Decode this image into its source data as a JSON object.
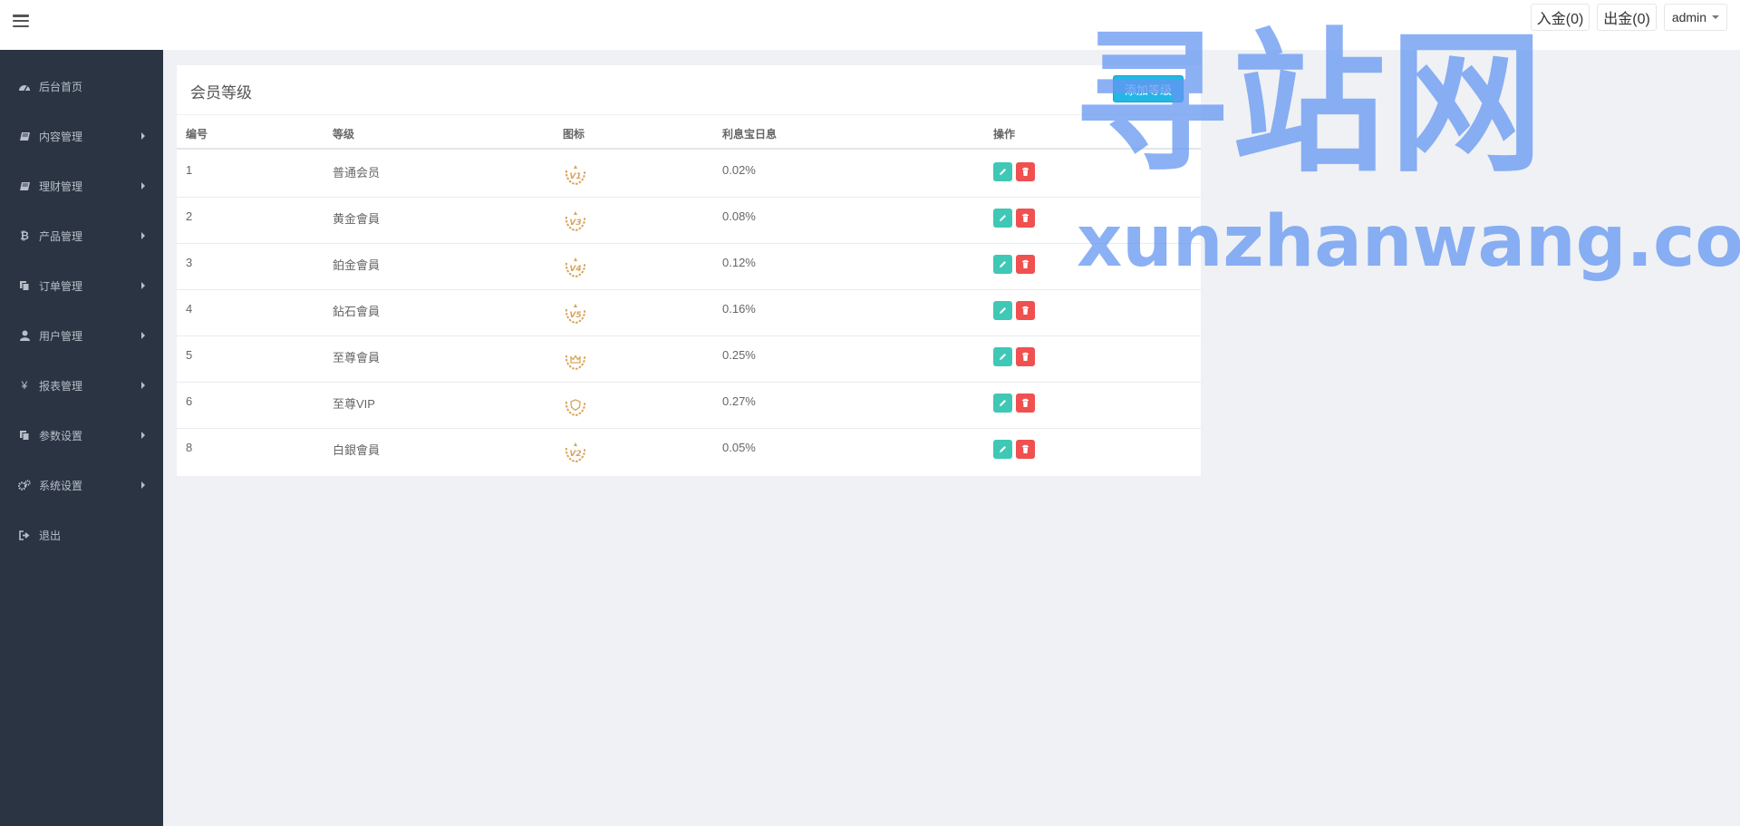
{
  "topbar": {
    "deposit_label": "入金(0)",
    "withdraw_label": "出金(0)",
    "user_label": "admin"
  },
  "sidebar": {
    "items": [
      {
        "label": "后台首页",
        "icon": "dashboard-icon",
        "has_arrow": false
      },
      {
        "label": "内容管理",
        "icon": "book-icon",
        "has_arrow": true
      },
      {
        "label": "理财管理",
        "icon": "book-icon",
        "has_arrow": true
      },
      {
        "label": "产品管理",
        "icon": "bitcoin-icon",
        "has_arrow": true
      },
      {
        "label": "订单管理",
        "icon": "copy-icon",
        "has_arrow": true
      },
      {
        "label": "用户管理",
        "icon": "user-icon",
        "has_arrow": true
      },
      {
        "label": "报表管理",
        "icon": "yen-icon",
        "has_arrow": true
      },
      {
        "label": "参数设置",
        "icon": "copy-icon",
        "has_arrow": true
      },
      {
        "label": "系统设置",
        "icon": "gears-icon",
        "has_arrow": true
      },
      {
        "label": "退出",
        "icon": "sign-out-icon",
        "has_arrow": false
      }
    ]
  },
  "panel": {
    "title": "会员等级",
    "add_button": "添加等级",
    "columns": [
      "编号",
      "等级",
      "图标",
      "利息宝日息",
      "操作"
    ],
    "rows": [
      {
        "id": "1",
        "level": "普通会员",
        "badge": "V1",
        "rate": "0.02%"
      },
      {
        "id": "2",
        "level": "黄金會員",
        "badge": "V3",
        "rate": "0.08%"
      },
      {
        "id": "3",
        "level": "鉑金會員",
        "badge": "V4",
        "rate": "0.12%"
      },
      {
        "id": "4",
        "level": "鉆石會員",
        "badge": "V5",
        "rate": "0.16%"
      },
      {
        "id": "5",
        "level": "至尊會員",
        "badge": "crown",
        "rate": "0.25%"
      },
      {
        "id": "6",
        "level": "至尊VIP",
        "badge": "shield",
        "rate": "0.27%"
      },
      {
        "id": "8",
        "level": "白銀會員",
        "badge": "V2",
        "rate": "0.05%"
      }
    ]
  },
  "watermark": {
    "main": "寻站网",
    "sub": "xunzhanwang.com"
  },
  "colors": {
    "sidebar_bg": "#2a3442",
    "edit_button": "#3fc8b5",
    "delete_button": "#f05050",
    "add_button": "#23b7e5",
    "badge_gold": "#d9a35a"
  }
}
